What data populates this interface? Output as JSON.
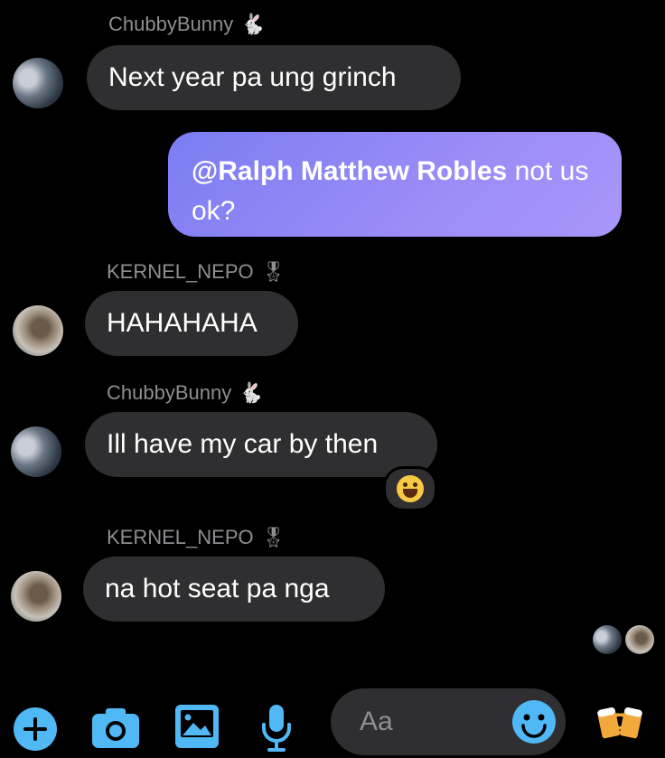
{
  "messages": [
    {
      "sender": "ChubbyBunny",
      "sender_emoji": "🐇",
      "text": "Next year pa ung grinch"
    },
    {
      "mine": true,
      "mention": "@Ralph Matthew Robles",
      "text": " not us ok?"
    },
    {
      "sender": "KERNEL_NEPO",
      "sender_emoji": "🎖",
      "text": "HAHAHAHA"
    },
    {
      "sender": "ChubbyBunny",
      "sender_emoji": "🐇",
      "text": "Ill have my car by then",
      "reaction": "laughing-face"
    },
    {
      "sender": "KERNEL_NEPO",
      "sender_emoji": "🎖",
      "text": "na hot seat pa nga"
    }
  ],
  "composer": {
    "placeholder": "Aa",
    "icons": [
      "plus-icon",
      "camera-icon",
      "image-icon",
      "microphone-icon",
      "emoji-icon",
      "beer-mugs-icon"
    ],
    "accent": "#4fb8f5"
  },
  "colors": {
    "background": "#000000",
    "bubble_incoming": "#2f2f31",
    "bubble_outgoing": "#8f86f6",
    "sender_name": "#8e8e93"
  }
}
